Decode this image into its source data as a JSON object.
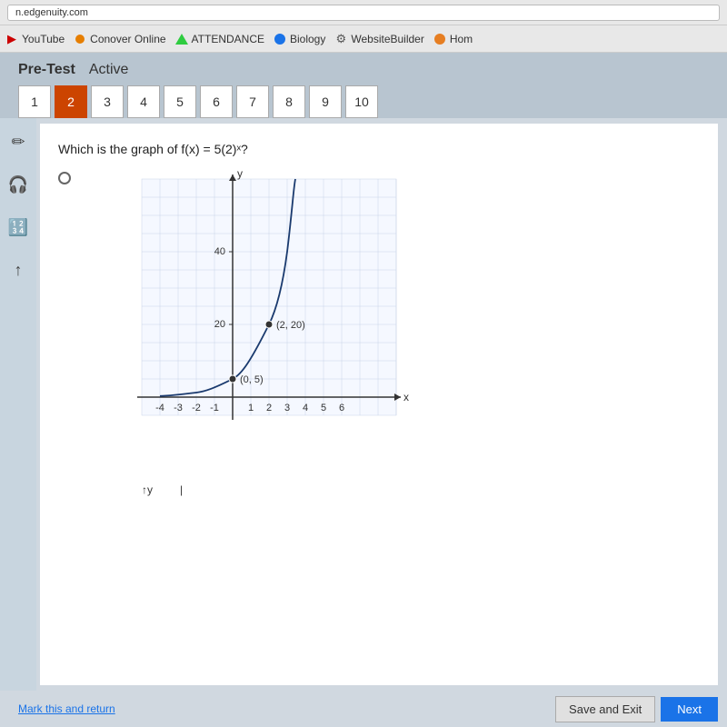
{
  "browser": {
    "url": "n.edgenuity.com",
    "bookmarks": [
      {
        "label": "YouTube",
        "icon": "youtube"
      },
      {
        "label": "Conover Online",
        "icon": "orange-dot"
      },
      {
        "label": "ATTENDANCE",
        "icon": "triangle"
      },
      {
        "label": "Biology",
        "icon": "circle"
      },
      {
        "label": "WebsiteBuilder",
        "icon": "gear"
      },
      {
        "label": "Hom",
        "icon": "orange-circle"
      }
    ]
  },
  "header": {
    "pre_test_label": "Pre-Test",
    "active_label": "Active"
  },
  "question_numbers": [
    1,
    2,
    3,
    4,
    5,
    6,
    7,
    8,
    9,
    10
  ],
  "current_question": 2,
  "question": {
    "text": "Which is the graph of f(x) = 5(2)ˣ?",
    "function": "f(x) = 5(2)^x"
  },
  "graph": {
    "x_label": "x",
    "y_label": "y",
    "x_axis_values": [
      "-4",
      "-3",
      "-2",
      "-1",
      "1",
      "2",
      "3",
      "4",
      "5",
      "6"
    ],
    "y_axis_values": [
      "20",
      "40"
    ],
    "labeled_points": [
      {
        "label": "(2, 20)",
        "x": 2,
        "y": 20
      },
      {
        "label": "(0, 5)",
        "x": 0,
        "y": 5
      }
    ]
  },
  "bottom": {
    "mark_return_label": "Mark this and return",
    "save_exit_label": "Save and Exit",
    "next_label": "Next"
  }
}
